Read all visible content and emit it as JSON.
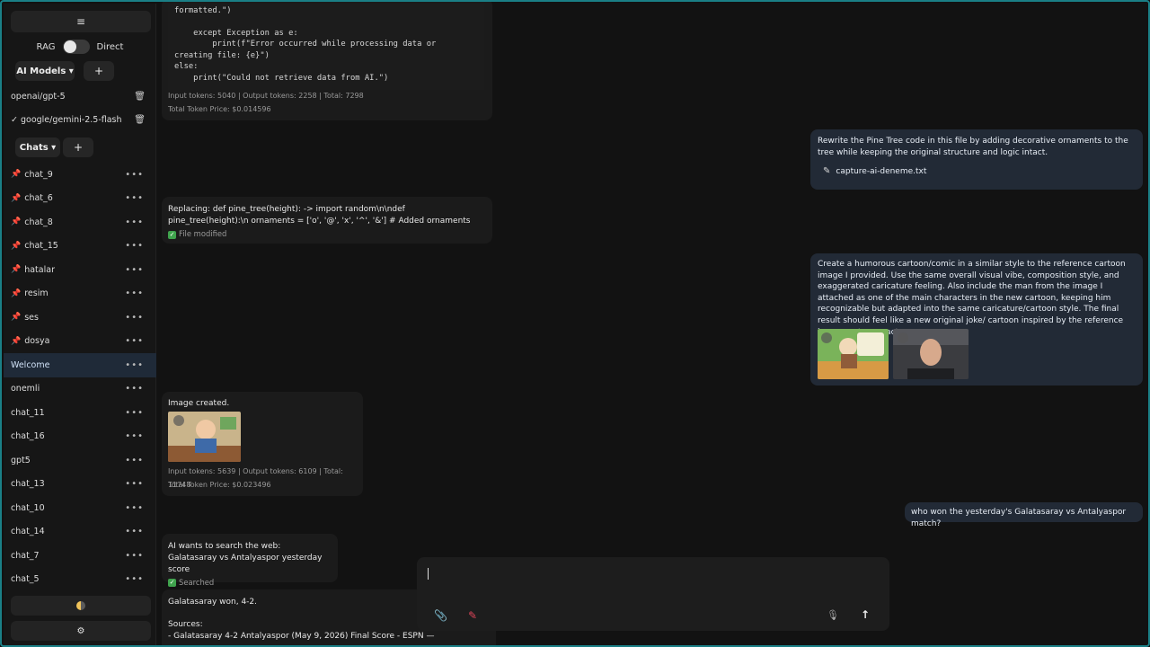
{
  "sidebar": {
    "menu_glyph": "≡",
    "rag_label": "RAG",
    "direct_label": "Direct",
    "ai_models_label": "AI Models ▾",
    "add_glyph": "+",
    "models": [
      {
        "name": "openai/gpt-5"
      },
      {
        "name": "✓ google/gemini-2.5-flash"
      }
    ],
    "chats_label": "Chats ▾",
    "chats": [
      {
        "name": "chat_9",
        "pinned": true
      },
      {
        "name": "chat_6",
        "pinned": true
      },
      {
        "name": "chat_8",
        "pinned": true
      },
      {
        "name": "chat_15",
        "pinned": true
      },
      {
        "name": "hatalar",
        "pinned": true
      },
      {
        "name": "resim",
        "pinned": true
      },
      {
        "name": "ses",
        "pinned": true
      },
      {
        "name": "dosya",
        "pinned": true
      },
      {
        "name": "Welcome",
        "pinned": false,
        "active": true
      },
      {
        "name": "onemli",
        "pinned": false
      },
      {
        "name": "chat_11",
        "pinned": false
      },
      {
        "name": "chat_16",
        "pinned": false
      },
      {
        "name": "gpt5",
        "pinned": false
      },
      {
        "name": "chat_13",
        "pinned": false
      },
      {
        "name": "chat_10",
        "pinned": false
      },
      {
        "name": "chat_14",
        "pinned": false
      },
      {
        "name": "chat_7",
        "pinned": false
      },
      {
        "name": "chat_5",
        "pinned": false
      }
    ],
    "dots_glyph": "•••",
    "settings_glyph": "⚙"
  },
  "messages": {
    "code_block": "formatted.\")\n\n    except Exception as e:\n        print(f\"Error occurred while processing data or\ncreating file: {e}\")\nelse:\n    print(\"Could not retrieve data from AI.\")",
    "code_meta_tokens": "Input tokens: 5040 | Output tokens: 2258 | Total: 7298",
    "code_meta_price": "Total Token Price: $0.014596",
    "user_pine": "Rewrite the Pine Tree code in this file by adding decorative ornaments to the tree while keeping the original structure and logic intact.",
    "user_pine_file": "capture-ai-deneme.txt",
    "replace_text": "Replacing: def pine_tree(height):  ->  import random\\n\\ndef pine_tree(height):\\n ornaments = ['o', '@', 'x', '^', '&'] # Added ornaments",
    "replace_status": "File modified",
    "user_cartoon": "Create a humorous cartoon/comic in a similar style to the reference cartoon image I provided. Use the same overall visual vibe, composition style, and exaggerated caricature feeling. Also include the man from the image I attached as one of the main characters in the new cartoon, keeping him recognizable but adapted into the same caricature/cartoon style. The final result should feel like a new original joke/ cartoon inspired by the reference image, not an exact copy.",
    "image_created": "Image created.",
    "image_meta_tokens": "Input tokens: 5639 | Output tokens: 6109 | Total: 11748",
    "image_meta_price": "Total Token Price: $0.023496",
    "user_match": "who won the yesterday's Galatasaray vs Antalyaspor match?",
    "search_intro": "AI wants to search the web:",
    "search_query": "Galatasaray vs Antalyaspor yesterday score",
    "search_status": "Searched",
    "answer": "Galatasaray won, 4-2.",
    "sources_label": "Sources:",
    "source_1": "- Galatasaray 4-2 Antalyaspor (May 9, 2026) Final Score - ESPN —"
  },
  "composer": {
    "mic_glyph": "🎙",
    "send_glyph": "↑"
  }
}
